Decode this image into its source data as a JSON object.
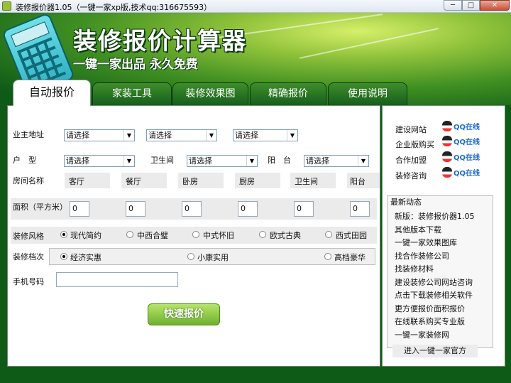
{
  "window": {
    "title": "装修报价器1.05（一键一家xp版,技术qq:316675593）",
    "min": "─",
    "max": "□",
    "close": "✕"
  },
  "banner": {
    "title": "装修报价计算器",
    "subtitle": "一键一家出品 永久免费"
  },
  "tabs": [
    "自动报价",
    "家装工具",
    "装修效果图",
    "精确报价",
    "使用说明"
  ],
  "form": {
    "address_label": "业主地址",
    "address_selects": [
      "请选择",
      "请选择",
      "请选择"
    ],
    "huxing_label": "户　型",
    "huxing_select": "请选择",
    "bathroom_label": "卫生间",
    "bathroom_select": "请选择",
    "balcony_label": "阳　台",
    "balcony_select": "请选择",
    "room_label": "房间名称",
    "rooms": [
      "客厅",
      "餐厅",
      "卧房",
      "厨房",
      "卫生间",
      "阳台"
    ],
    "area_label": "面积（平方米）",
    "areas": [
      "0",
      "0",
      "0",
      "0",
      "0",
      "0"
    ],
    "style_label": "装修风格",
    "styles": [
      "现代简约",
      "中西合璧",
      "中式怀旧",
      "欧式古典",
      "西式田园"
    ],
    "style_selected": "现代简约",
    "grade_label": "装修档次",
    "grades": [
      "经济实惠",
      "小康实用",
      "高档豪华"
    ],
    "grade_selected": "经济实惠",
    "phone_label": "手机号码",
    "phone_value": "",
    "submit_label": "快速报价"
  },
  "contacts": [
    {
      "label": "建设网站",
      "qq": "QQ在线"
    },
    {
      "label": "企业版购买",
      "qq": "QQ在线"
    },
    {
      "label": "合作加盟",
      "qq": "QQ在线"
    },
    {
      "label": "装修咨询",
      "qq": "QQ在线"
    }
  ],
  "news": {
    "title": "最新动态",
    "items": [
      "新版：装修报价器1.05",
      "其他版本下载",
      "一键一家效果图库",
      "找合作装修公司",
      "找装修材料",
      "建设装修公司网站咨询",
      "点击下载装修相关软件",
      "更方便报价面积报价",
      "在线联系购买专业版",
      "一键一家装修网"
    ]
  },
  "footer_link": "进入一键一家官方"
}
